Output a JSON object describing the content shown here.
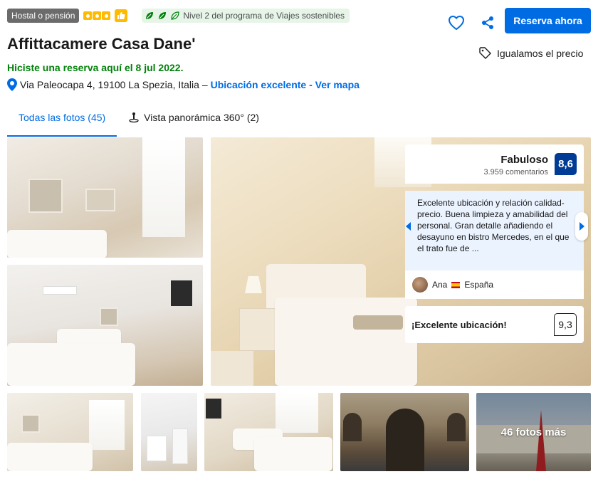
{
  "header": {
    "type_badge": "Hostal o pensión",
    "star_count": 3,
    "sustainability": "Nivel 2 del programa de Viajes sostenibles",
    "title": "Affittacamere Casa Dane'",
    "booked_note": "Hiciste una reserva aquí el 8 jul 2022.",
    "address": "Via Paleocapa 4, 19100 La Spezia, Italia –",
    "location_link": "Ubicación excelente - Ver mapa",
    "reserve_label": "Reserva ahora",
    "price_match": "Igualamos el precio"
  },
  "tabs": [
    {
      "label": "Todas las fotos (45)",
      "active": true
    },
    {
      "label": "Vista panorámica 360° (2)",
      "active": false
    }
  ],
  "gallery": {
    "more_label": "46 fotos más"
  },
  "rating": {
    "label": "Fabuloso",
    "count": "3.959 comentarios",
    "score": "8,6"
  },
  "review": {
    "text": "Excelente ubicación y relación calidad-precio. Buena limpieza y amabilidad del personal. Gran detalle añadiendo el desayuno en bistro Mercedes, en el que el trato fue de ...",
    "author": "Ana",
    "country": "España"
  },
  "location_score": {
    "label": "¡Excelente ubicación!",
    "score": "9,3"
  },
  "colors": {
    "primary": "#006ce4",
    "score_bg": "#003b95",
    "booked_green": "#008009",
    "star_yellow": "#febb02"
  }
}
